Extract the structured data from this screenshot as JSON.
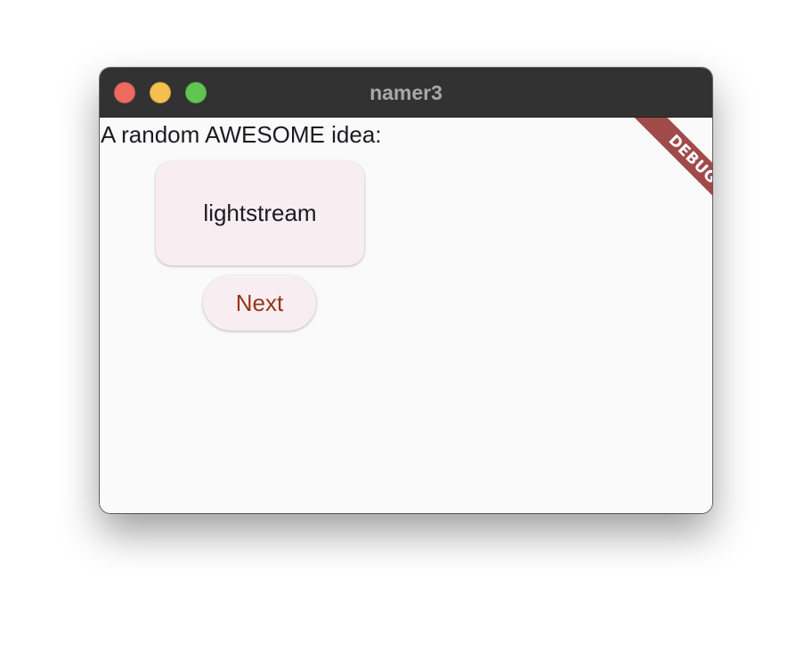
{
  "window": {
    "title": "namer3",
    "traffic_lights": {
      "close_color": "#ed6a5e",
      "minimize_color": "#f5bf4f",
      "maximize_color": "#61c554"
    }
  },
  "main": {
    "heading": "A random AWESOME idea:",
    "word_pair": "lightstream",
    "next_button_label": "Next"
  },
  "debug_banner": {
    "label": "DEBUG",
    "color": "#a04a4a"
  },
  "colors": {
    "accent_text": "#993318",
    "card_background": "#f8eef2",
    "titlebar": "#323232"
  }
}
